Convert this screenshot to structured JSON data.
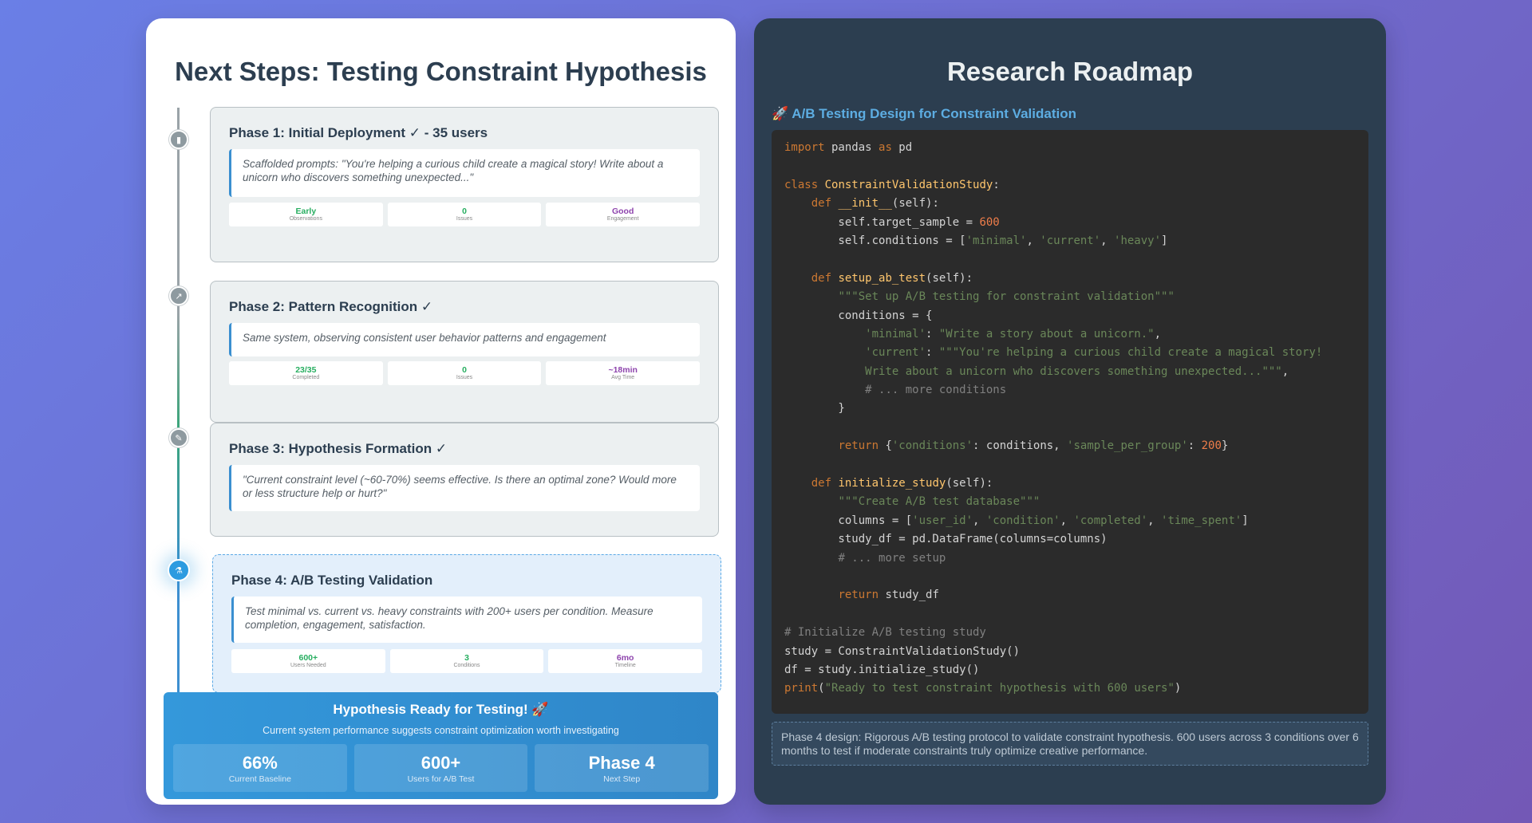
{
  "left": {
    "title": "Next Steps: Testing Constraint Hypothesis",
    "phases": [
      {
        "icon": "bar-chart-icon",
        "title": "Phase 1: Initial Deployment ✓ - 35 users",
        "quote": "Scaffolded prompts: \"You're helping a curious child create a magical story! Write about a unicorn who discovers something unexpected...\"",
        "metrics": [
          {
            "value": "Early",
            "label": "Observations"
          },
          {
            "value": "0",
            "label": "Issues"
          },
          {
            "value": "Good",
            "label": "Engagement"
          }
        ]
      },
      {
        "icon": "line-chart-icon",
        "title": "Phase 2: Pattern Recognition ✓",
        "quote": "Same system, observing consistent user behavior patterns and engagement",
        "metrics": [
          {
            "value": "23/35",
            "label": "Completed"
          },
          {
            "value": "0",
            "label": "Issues"
          },
          {
            "value": "~18min",
            "label": "Avg Time"
          }
        ]
      },
      {
        "icon": "microscope-icon",
        "title": "Phase 3: Hypothesis Formation ✓",
        "quote": "\"Current constraint level (~60-70%) seems effective. Is there an optimal zone? Would more or less structure help or hurt?\"",
        "metrics": []
      },
      {
        "icon": "test-tube-icon",
        "title": "Phase 4: A/B Testing Validation",
        "quote": "Test minimal vs. current vs. heavy constraints with 200+ users per condition. Measure completion, engagement, satisfaction.",
        "metrics": [
          {
            "value": "600+",
            "label": "Users Needed"
          },
          {
            "value": "3",
            "label": "Conditions"
          },
          {
            "value": "6mo",
            "label": "Timeline"
          }
        ]
      }
    ],
    "ready": {
      "title": "Hypothesis Ready for Testing! 🚀",
      "subtitle": "Current system performance suggests constraint optimization worth investigating",
      "stats": [
        {
          "value": "66%",
          "label": "Current Baseline"
        },
        {
          "value": "600+",
          "label": "Users for A/B Test"
        },
        {
          "value": "Phase 4",
          "label": "Next Step"
        }
      ]
    }
  },
  "right": {
    "title": "Research Roadmap",
    "section_heading": "🚀 A/B Testing Design for Constraint Validation",
    "code_lines": [
      [
        [
          "kw",
          "import"
        ],
        [
          "t",
          " pandas "
        ],
        [
          "kw",
          "as"
        ],
        [
          "t",
          " pd"
        ]
      ],
      [],
      [
        [
          "kw",
          "class"
        ],
        [
          "t",
          " "
        ],
        [
          "fn",
          "ConstraintValidationStudy"
        ],
        [
          "t",
          ":"
        ]
      ],
      [
        [
          "t",
          "    "
        ],
        [
          "kw",
          "def"
        ],
        [
          "t",
          " "
        ],
        [
          "fn",
          "__init__"
        ],
        [
          "t",
          "(self):"
        ]
      ],
      [
        [
          "t",
          "        self.target_sample = "
        ],
        [
          "num",
          "600"
        ]
      ],
      [
        [
          "t",
          "        self.conditions = ["
        ],
        [
          "str",
          "'minimal'"
        ],
        [
          "t",
          ", "
        ],
        [
          "str",
          "'current'"
        ],
        [
          "t",
          ", "
        ],
        [
          "str",
          "'heavy'"
        ],
        [
          "t",
          "]"
        ]
      ],
      [],
      [
        [
          "t",
          "    "
        ],
        [
          "kw",
          "def"
        ],
        [
          "t",
          " "
        ],
        [
          "fn",
          "setup_ab_test"
        ],
        [
          "t",
          "(self):"
        ]
      ],
      [
        [
          "t",
          "        "
        ],
        [
          "str",
          "\"\"\"Set up A/B testing for constraint validation\"\"\""
        ]
      ],
      [
        [
          "t",
          "        conditions = {"
        ]
      ],
      [
        [
          "t",
          "            "
        ],
        [
          "str",
          "'minimal'"
        ],
        [
          "t",
          ": "
        ],
        [
          "str",
          "\"Write a story about a unicorn.\""
        ],
        [
          "t",
          ","
        ]
      ],
      [
        [
          "t",
          "            "
        ],
        [
          "str",
          "'current'"
        ],
        [
          "t",
          ": "
        ],
        [
          "str",
          "\"\"\"You're helping a curious child create a magical story!"
        ]
      ],
      [
        [
          "str",
          "            Write about a unicorn who discovers something unexpected...\"\"\""
        ],
        [
          "t",
          ","
        ]
      ],
      [
        [
          "t",
          "            "
        ],
        [
          "cmt",
          "# ... more conditions"
        ]
      ],
      [
        [
          "t",
          "        }"
        ]
      ],
      [],
      [
        [
          "t",
          "        "
        ],
        [
          "kw",
          "return"
        ],
        [
          "t",
          " {"
        ],
        [
          "str",
          "'conditions'"
        ],
        [
          "t",
          ": conditions, "
        ],
        [
          "str",
          "'sample_per_group'"
        ],
        [
          "t",
          ": "
        ],
        [
          "num",
          "200"
        ],
        [
          "t",
          "}"
        ]
      ],
      [],
      [
        [
          "t",
          "    "
        ],
        [
          "kw",
          "def"
        ],
        [
          "t",
          " "
        ],
        [
          "fn",
          "initialize_study"
        ],
        [
          "t",
          "(self):"
        ]
      ],
      [
        [
          "t",
          "        "
        ],
        [
          "str",
          "\"\"\"Create A/B test database\"\"\""
        ]
      ],
      [
        [
          "t",
          "        columns = ["
        ],
        [
          "str",
          "'user_id'"
        ],
        [
          "t",
          ", "
        ],
        [
          "str",
          "'condition'"
        ],
        [
          "t",
          ", "
        ],
        [
          "str",
          "'completed'"
        ],
        [
          "t",
          ", "
        ],
        [
          "str",
          "'time_spent'"
        ],
        [
          "t",
          "]"
        ]
      ],
      [
        [
          "t",
          "        study_df = pd.DataFrame(columns=columns)"
        ]
      ],
      [
        [
          "t",
          "        "
        ],
        [
          "cmt",
          "# ... more setup"
        ]
      ],
      [],
      [
        [
          "t",
          "        "
        ],
        [
          "kw",
          "return"
        ],
        [
          "t",
          " study_df"
        ]
      ],
      [],
      [
        [
          "cmt",
          "# Initialize A/B testing study"
        ]
      ],
      [
        [
          "t",
          "study = ConstraintValidationStudy()"
        ]
      ],
      [
        [
          "t",
          "df = study.initialize_study()"
        ]
      ],
      [
        [
          "kw",
          "print"
        ],
        [
          "t",
          "("
        ],
        [
          "str",
          "\"Ready to test constraint hypothesis with 600 users\""
        ],
        [
          "t",
          ")"
        ]
      ]
    ],
    "note": "Phase 4 design: Rigorous A/B testing protocol to validate constraint hypothesis. 600 users across 3 conditions over 6 months to test if moderate constraints truly optimize creative performance."
  },
  "colors": {
    "accent_blue": "#3498db",
    "metric_green": "#27ae60",
    "metric_purple": "#8e44ad",
    "code_bg": "#2b2b2b",
    "dark_panel": "#2c3e50"
  }
}
